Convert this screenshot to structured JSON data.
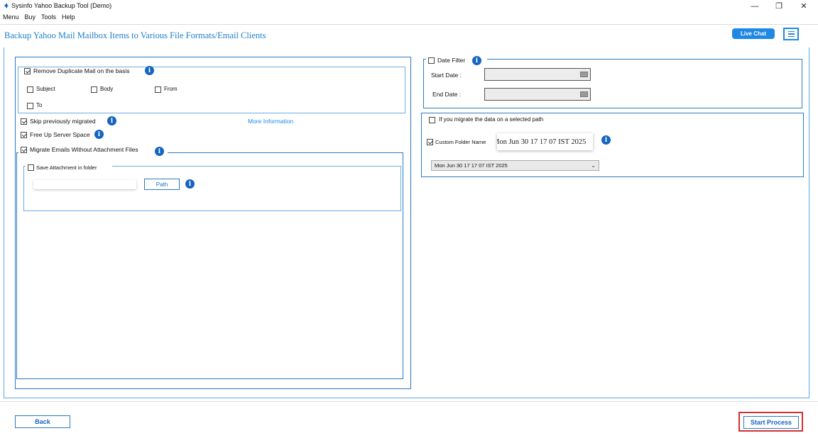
{
  "window": {
    "title": "Sysinfo Yahoo Backup Tool (Demo)",
    "minimize": "—",
    "restore": "❐",
    "close": "✕"
  },
  "menu": {
    "items": [
      "Menu",
      "Buy",
      "Tools",
      "Help"
    ]
  },
  "header": {
    "title": "Backup Yahoo Mail Mailbox Items to Various File Formats/Email Clients",
    "live_chat": "Live Chat"
  },
  "left": {
    "remove_duplicate": {
      "label": "Remove Duplicate Mail on the basis",
      "checked": true
    },
    "dup_options": [
      {
        "label": "Subject",
        "checked": false
      },
      {
        "label": "Body",
        "checked": false
      },
      {
        "label": "From",
        "checked": false
      },
      {
        "label": "To",
        "checked": false
      }
    ],
    "skip_migrated": {
      "label": "Skip previously migrated",
      "checked": true
    },
    "more_info": "More Information",
    "free_space": {
      "label": "Free Up Server Space",
      "checked": true
    },
    "migrate_without_attach": {
      "label": "Migrate Emails Without Attachment Files",
      "checked": true
    },
    "save_attach": {
      "label": "Save Attachment in folder",
      "checked": false
    },
    "path_value": "",
    "path_button": "Path"
  },
  "right": {
    "date_filter": {
      "label": "Date Filter",
      "checked": false
    },
    "start_date_label": "Start Date :",
    "end_date_label": "End Date :",
    "selected_path": {
      "label": "If you migrate the data on a selected path",
      "checked": false
    },
    "custom_folder": {
      "label": "Custom Folder Name",
      "checked": true
    },
    "folder_name_value": "Mon Jun 30 17 17 07 IST 2025",
    "folder_select_value": "Mon Jun 30 17 17 07 IST 2025"
  },
  "footer": {
    "back": "Back",
    "start": "Start Process"
  },
  "colors": {
    "accent": "#1e88e5",
    "border": "#2b79c0",
    "highlight": "#d32f2f"
  }
}
